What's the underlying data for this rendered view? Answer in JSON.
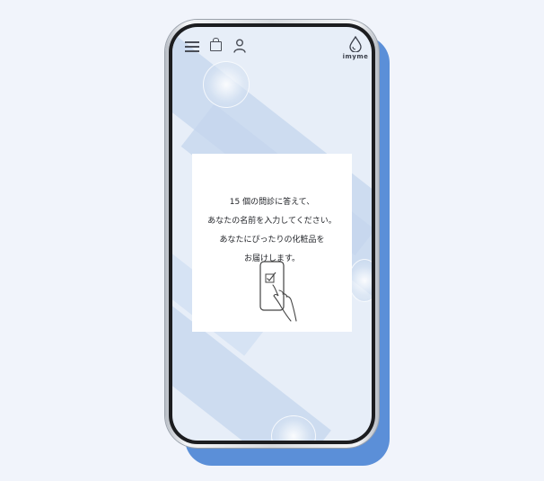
{
  "app": {
    "brand": "imyme"
  },
  "header": {
    "icons": [
      "menu-icon",
      "shopping-bag-icon",
      "user-icon",
      "droplet-logo-icon"
    ]
  },
  "content": {
    "lines": [
      "15 個の問診に答えて、",
      "あなたの名前を入力してください。",
      "あなたにぴったりの化粧品を",
      "お届けします。"
    ],
    "illustration": "hand-tapping-phone-checkbox-icon"
  },
  "colors": {
    "background": "#f1f4fb",
    "phone_shadow": "#5b8fd8",
    "card": "#ffffff",
    "text": "#222429"
  }
}
